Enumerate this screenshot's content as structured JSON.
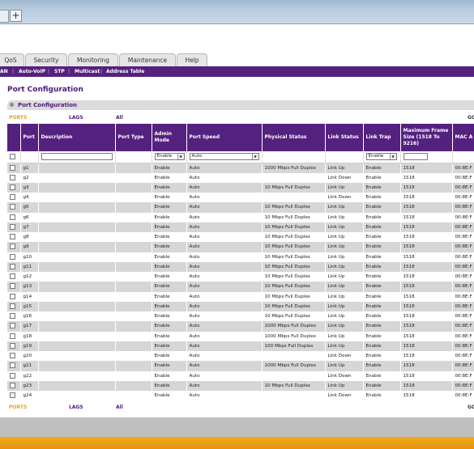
{
  "browser": {
    "new_tab_glyph": "+"
  },
  "tabs": [
    "QoS",
    "Security",
    "Monitoring",
    "Maintenance",
    "Help"
  ],
  "subnav": [
    "AN",
    "Auto-VoIP",
    "STP",
    "Multicast",
    "Address Table"
  ],
  "page_title": "Port Configuration",
  "panel_title": "Port Configuration",
  "filter": {
    "ports": "PORTS",
    "lags": "LAGS",
    "all": "All",
    "go": "GO"
  },
  "columns": [
    "Port",
    "Description",
    "Port Type",
    "Admin Mode",
    "Port Speed",
    "Physical Status",
    "Link Status",
    "Link Trap",
    "Maximum Frame Size (1518 To 9216)",
    "MAC A"
  ],
  "filter_row": {
    "admin_mode": "Enable",
    "port_speed": "Auto",
    "link_trap": "Enable"
  },
  "rows": [
    {
      "port": "g1",
      "admin": "Enable",
      "speed": "Auto",
      "phys": "1000 Mbps Full Duplex",
      "link": "Link Up",
      "trap": "Enable",
      "frame": "1518",
      "mac": "00:8E:F"
    },
    {
      "port": "g2",
      "admin": "Enable",
      "speed": "Auto",
      "phys": "",
      "link": "Link Down",
      "trap": "Enable",
      "frame": "1518",
      "mac": "00:8E:F"
    },
    {
      "port": "g3",
      "admin": "Enable",
      "speed": "Auto",
      "phys": "10 Mbps Full Duplex",
      "link": "Link Up",
      "trap": "Enable",
      "frame": "1518",
      "mac": "00:8E:F"
    },
    {
      "port": "g4",
      "admin": "Enable",
      "speed": "Auto",
      "phys": "",
      "link": "Link Down",
      "trap": "Enable",
      "frame": "1518",
      "mac": "00:8E:F"
    },
    {
      "port": "g5",
      "admin": "Enable",
      "speed": "Auto",
      "phys": "10 Mbps Full Duplex",
      "link": "Link Up",
      "trap": "Enable",
      "frame": "1518",
      "mac": "00:8E:F"
    },
    {
      "port": "g6",
      "admin": "Enable",
      "speed": "Auto",
      "phys": "10 Mbps Full Duplex",
      "link": "Link Up",
      "trap": "Enable",
      "frame": "1518",
      "mac": "00:8E:F"
    },
    {
      "port": "g7",
      "admin": "Enable",
      "speed": "Auto",
      "phys": "10 Mbps Full Duplex",
      "link": "Link Up",
      "trap": "Enable",
      "frame": "1518",
      "mac": "00:8E:F"
    },
    {
      "port": "g8",
      "admin": "Enable",
      "speed": "Auto",
      "phys": "10 Mbps Full Duplex",
      "link": "Link Up",
      "trap": "Enable",
      "frame": "1518",
      "mac": "00:8E:F"
    },
    {
      "port": "g9",
      "admin": "Enable",
      "speed": "Auto",
      "phys": "10 Mbps Full Duplex",
      "link": "Link Up",
      "trap": "Enable",
      "frame": "1518",
      "mac": "00:8E:F"
    },
    {
      "port": "g10",
      "admin": "Enable",
      "speed": "Auto",
      "phys": "10 Mbps Full Duplex",
      "link": "Link Up",
      "trap": "Enable",
      "frame": "1518",
      "mac": "00:8E:F"
    },
    {
      "port": "g11",
      "admin": "Enable",
      "speed": "Auto",
      "phys": "10 Mbps Full Duplex",
      "link": "Link Up",
      "trap": "Enable",
      "frame": "1518",
      "mac": "00:8E:F"
    },
    {
      "port": "g12",
      "admin": "Enable",
      "speed": "Auto",
      "phys": "10 Mbps Full Duplex",
      "link": "Link Up",
      "trap": "Enable",
      "frame": "1518",
      "mac": "00:8E:F"
    },
    {
      "port": "g13",
      "admin": "Enable",
      "speed": "Auto",
      "phys": "10 Mbps Full Duplex",
      "link": "Link Up",
      "trap": "Enable",
      "frame": "1518",
      "mac": "00:8E:F"
    },
    {
      "port": "g14",
      "admin": "Enable",
      "speed": "Auto",
      "phys": "10 Mbps Full Duplex",
      "link": "Link Up",
      "trap": "Enable",
      "frame": "1518",
      "mac": "00:8E:F"
    },
    {
      "port": "g15",
      "admin": "Enable",
      "speed": "Auto",
      "phys": "10 Mbps Full Duplex",
      "link": "Link Up",
      "trap": "Enable",
      "frame": "1518",
      "mac": "00:8E:F"
    },
    {
      "port": "g16",
      "admin": "Enable",
      "speed": "Auto",
      "phys": "10 Mbps Full Duplex",
      "link": "Link Up",
      "trap": "Enable",
      "frame": "1518",
      "mac": "00:8E:F"
    },
    {
      "port": "g17",
      "admin": "Enable",
      "speed": "Auto",
      "phys": "1000 Mbps Full Duplex",
      "link": "Link Up",
      "trap": "Enable",
      "frame": "1518",
      "mac": "00:8E:F"
    },
    {
      "port": "g18",
      "admin": "Enable",
      "speed": "Auto",
      "phys": "1000 Mbps Full Duplex",
      "link": "Link Up",
      "trap": "Enable",
      "frame": "1518",
      "mac": "00:8E:F"
    },
    {
      "port": "g19",
      "admin": "Enable",
      "speed": "Auto",
      "phys": "100 Mbps Full Duplex",
      "link": "Link Up",
      "trap": "Enable",
      "frame": "1518",
      "mac": "00:8E:F"
    },
    {
      "port": "g20",
      "admin": "Enable",
      "speed": "Auto",
      "phys": "",
      "link": "Link Down",
      "trap": "Enable",
      "frame": "1518",
      "mac": "00:8E:F"
    },
    {
      "port": "g21",
      "admin": "Enable",
      "speed": "Auto",
      "phys": "1000 Mbps Full Duplex",
      "link": "Link Up",
      "trap": "Enable",
      "frame": "1518",
      "mac": "00:8E:F"
    },
    {
      "port": "g22",
      "admin": "Enable",
      "speed": "Auto",
      "phys": "",
      "link": "Link Down",
      "trap": "Enable",
      "frame": "1518",
      "mac": "00:8E:F"
    },
    {
      "port": "g23",
      "admin": "Enable",
      "speed": "Auto",
      "phys": "10 Mbps Full Duplex",
      "link": "Link Up",
      "trap": "Enable",
      "frame": "1518",
      "mac": "00:8E:F"
    },
    {
      "port": "g24",
      "admin": "Enable",
      "speed": "Auto",
      "phys": "",
      "link": "Link Down",
      "trap": "Enable",
      "frame": "1518",
      "mac": "00:8E:F"
    }
  ],
  "colors": {
    "header_purple": "#55217f",
    "title_purple": "#4b1a7a",
    "ports_orange": "#e8a21a",
    "row_gray": "#d6d6d6",
    "footer_orange": "#f3a91d"
  }
}
